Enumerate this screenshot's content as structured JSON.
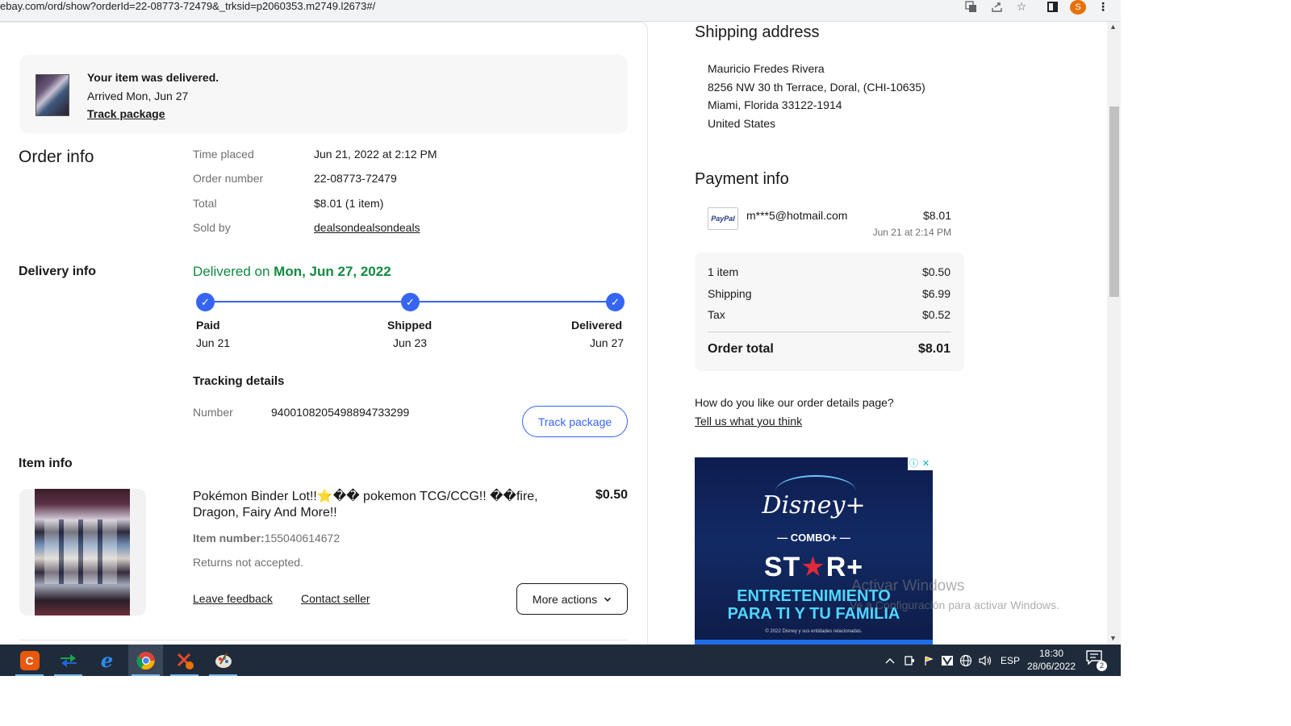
{
  "browser": {
    "url": "ebay.com/ord/show?orderId=22-08773-72479&_trksid=p2060353.m2749.l2673#/",
    "profile_initial": "S",
    "icons": [
      "translate-icon",
      "share-icon",
      "star-icon",
      "sidepanel-icon",
      "profile-avatar",
      "menu-kebab-icon"
    ]
  },
  "banner": {
    "title": "Your item was delivered.",
    "subtitle": "Arrived Mon, Jun 27",
    "link": "Track package"
  },
  "order_info": {
    "heading": "Order info",
    "rows": [
      {
        "label": "Time placed",
        "value": "Jun 21, 2022 at 2:12 PM"
      },
      {
        "label": "Order number",
        "value": "22-08773-72479"
      },
      {
        "label": "Total",
        "value": "$8.01 (1 item)"
      },
      {
        "label": "Sold by",
        "value": "dealsondealsondeals"
      }
    ]
  },
  "delivery_info": {
    "heading": "Delivery info",
    "status_prefix": "Delivered on ",
    "status_date": "Mon, Jun 27, 2022",
    "steps": [
      {
        "label": "Paid",
        "date": "Jun 21"
      },
      {
        "label": "Shipped",
        "date": "Jun 23"
      },
      {
        "label": "Delivered",
        "date": "Jun 27"
      }
    ],
    "tracking_heading": "Tracking details",
    "number_label": "Number",
    "number_value": "9400108205498894733299",
    "track_button": "Track package"
  },
  "item_info": {
    "heading": "Item info",
    "title": "Pokémon Binder Lot!!⭐️�� pokemon TCG/CCG!! ��fire, Dragon, Fairy And More!!",
    "price": "$0.50",
    "item_number_label": "Item number:",
    "item_number": "155040614672",
    "returns": "Returns not accepted.",
    "leave_feedback": "Leave feedback",
    "contact_seller": "Contact seller",
    "more_actions": "More actions"
  },
  "shipping": {
    "heading": "Shipping address",
    "lines": [
      "Mauricio Fredes Rivera",
      "8256 NW 30 th Terrace,  Doral, (CHI-10635)",
      "Miami, Florida 33122-1914",
      "United States"
    ]
  },
  "payment": {
    "heading": "Payment info",
    "method_logo": "PayPal",
    "email": "m***5@hotmail.com",
    "amount": "$8.01",
    "date": "Jun 21 at 2:14 PM",
    "summary": [
      {
        "label": "1 item",
        "value": "$0.50"
      },
      {
        "label": "Shipping",
        "value": "$6.99"
      },
      {
        "label": "Tax",
        "value": "$0.52"
      }
    ],
    "total_label": "Order total",
    "total_value": "$8.01"
  },
  "feedback": {
    "question": "How do you like our order details page?",
    "link": "Tell us what you think"
  },
  "ad": {
    "brand": "Disney+",
    "combo": "— COMBO+ —",
    "star_left": "ST",
    "star_mid": "★",
    "star_right": "R+",
    "tagline_1": "ENTRETENIMIENTO",
    "tagline_2": "PARA TI Y TU FAMILIA",
    "legal": "© 2022 Disney y sus entidades relacionadas.",
    "info_icon": "ⓘ",
    "close_icon": "✕"
  },
  "watermark": {
    "line1": "Activar Windows",
    "line2": "Ve a Configuración para activar Windows."
  },
  "taskbar": {
    "apps": [
      "ccleaner-app",
      "network-app",
      "internet-explorer-app",
      "chrome-app",
      "snipping-app",
      "paint-app"
    ],
    "language": "ESP",
    "time": "18:30",
    "date": "28/06/2022",
    "notification_count": "2"
  },
  "colors": {
    "accent_blue": "#3665f3",
    "delivered_green": "#118a3f",
    "taskbar_bg": "#1f2b3a"
  }
}
